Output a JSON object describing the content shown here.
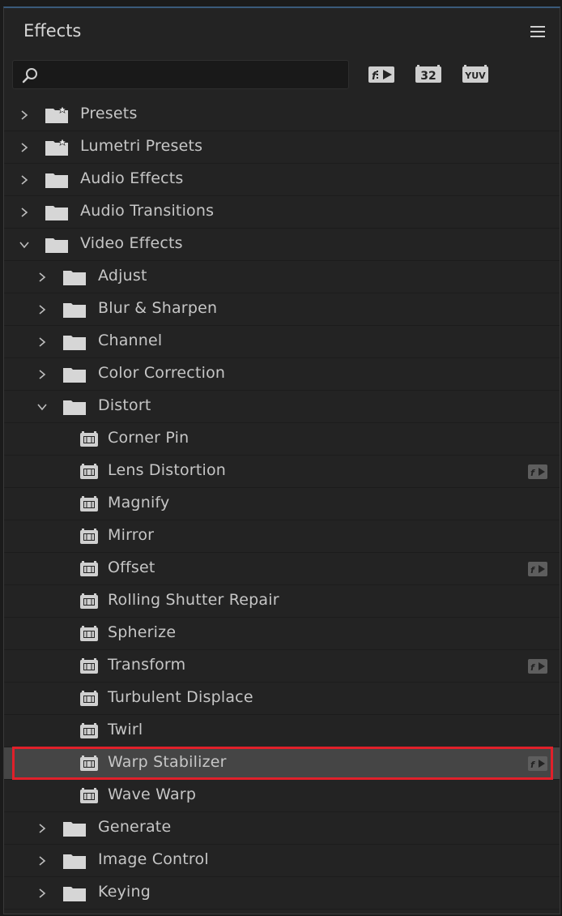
{
  "panel": {
    "title": "Effects",
    "menu_icon": "hamburger-menu-icon"
  },
  "search": {
    "value": "",
    "placeholder": "",
    "icon": "search-icon"
  },
  "filters": [
    {
      "name": "accelerated-effects-filter-button",
      "icon": "accelerated-effects-icon"
    },
    {
      "name": "32-bit-color-filter-button",
      "label": "32",
      "icon": "32-bit-icon"
    },
    {
      "name": "yuv-filter-button",
      "label": "YUV",
      "icon": "yuv-icon"
    }
  ],
  "tree": [
    {
      "label": "Presets",
      "level": 0,
      "type": "preset-folder",
      "expanded": false
    },
    {
      "label": "Lumetri Presets",
      "level": 0,
      "type": "preset-folder",
      "expanded": false
    },
    {
      "label": "Audio Effects",
      "level": 0,
      "type": "folder",
      "expanded": false
    },
    {
      "label": "Audio Transitions",
      "level": 0,
      "type": "folder",
      "expanded": false
    },
    {
      "label": "Video Effects",
      "level": 0,
      "type": "folder",
      "expanded": true
    },
    {
      "label": "Adjust",
      "level": 1,
      "type": "folder",
      "expanded": false
    },
    {
      "label": "Blur & Sharpen",
      "level": 1,
      "type": "folder",
      "expanded": false
    },
    {
      "label": "Channel",
      "level": 1,
      "type": "folder",
      "expanded": false
    },
    {
      "label": "Color Correction",
      "level": 1,
      "type": "folder",
      "expanded": false
    },
    {
      "label": "Distort",
      "level": 1,
      "type": "folder",
      "expanded": true
    },
    {
      "label": "Corner Pin",
      "level": 2,
      "type": "effect",
      "accelerated": false
    },
    {
      "label": "Lens Distortion",
      "level": 2,
      "type": "effect",
      "accelerated": true
    },
    {
      "label": "Magnify",
      "level": 2,
      "type": "effect",
      "accelerated": false
    },
    {
      "label": "Mirror",
      "level": 2,
      "type": "effect",
      "accelerated": false
    },
    {
      "label": "Offset",
      "level": 2,
      "type": "effect",
      "accelerated": true
    },
    {
      "label": "Rolling Shutter Repair",
      "level": 2,
      "type": "effect",
      "accelerated": false
    },
    {
      "label": "Spherize",
      "level": 2,
      "type": "effect",
      "accelerated": false
    },
    {
      "label": "Transform",
      "level": 2,
      "type": "effect",
      "accelerated": true
    },
    {
      "label": "Turbulent Displace",
      "level": 2,
      "type": "effect",
      "accelerated": false
    },
    {
      "label": "Twirl",
      "level": 2,
      "type": "effect",
      "accelerated": false
    },
    {
      "label": "Warp Stabilizer",
      "level": 2,
      "type": "effect",
      "accelerated": true,
      "selected": true
    },
    {
      "label": "Wave Warp",
      "level": 2,
      "type": "effect",
      "accelerated": false
    },
    {
      "label": "Generate",
      "level": 1,
      "type": "folder",
      "expanded": false
    },
    {
      "label": "Image Control",
      "level": 1,
      "type": "folder",
      "expanded": false
    },
    {
      "label": "Keying",
      "level": 1,
      "type": "folder",
      "expanded": false
    }
  ],
  "colors": {
    "panel_bg": "#232323",
    "selected_row": "#454545",
    "highlight_border": "#e0202a",
    "text": "#c6c6c6"
  }
}
